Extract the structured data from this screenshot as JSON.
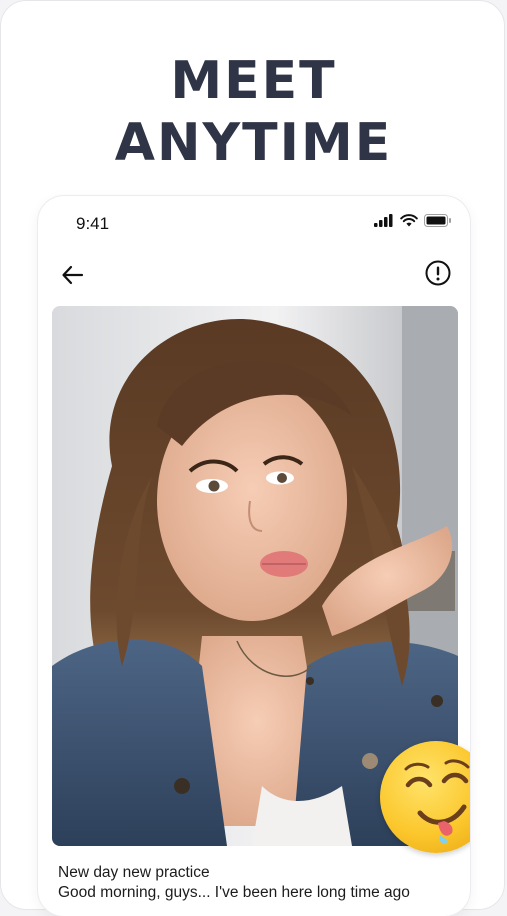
{
  "headline": {
    "line1": "MEET",
    "line2": "ANYTIME"
  },
  "status_bar": {
    "time": "9:41",
    "icons": [
      "signal-icon",
      "wifi-icon",
      "battery-icon"
    ]
  },
  "nav": {
    "back_icon": "arrow-left-icon",
    "report_icon": "exclamation-circle-icon"
  },
  "photo": {
    "sticker": "drooling-face-emoji"
  },
  "post": {
    "line1": "New day new practice",
    "line2": "Good morning, guys... I've been here long time ago"
  },
  "colors": {
    "headline": "#2f3447",
    "background": "#ffffff",
    "emoji": "#fbc72c"
  }
}
